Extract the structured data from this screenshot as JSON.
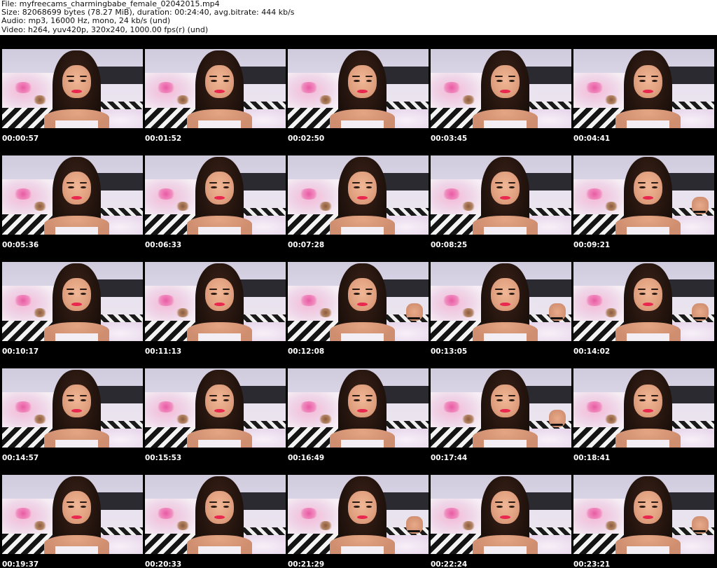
{
  "header": {
    "file": "File: myfreecams_charmingbabe_female_02042015.mp4",
    "size": "Size: 82068699 bytes (78.27 MiB), duration: 00:24:40, avg.bitrate: 444 kb/s",
    "audio": "Audio: mp3, 16000 Hz, mono, 24 kb/s (und)",
    "video": "Video: h264, yuv420p, 320x240, 1000.00 fps(r) (und)"
  },
  "thumbnails": [
    {
      "time": "00:00:57",
      "hand": false
    },
    {
      "time": "00:01:52",
      "hand": false
    },
    {
      "time": "00:02:50",
      "hand": false
    },
    {
      "time": "00:03:45",
      "hand": false
    },
    {
      "time": "00:04:41",
      "hand": false
    },
    {
      "time": "00:05:36",
      "hand": false
    },
    {
      "time": "00:06:33",
      "hand": false
    },
    {
      "time": "00:07:28",
      "hand": false
    },
    {
      "time": "00:08:25",
      "hand": false
    },
    {
      "time": "00:09:21",
      "hand": true
    },
    {
      "time": "00:10:17",
      "hand": false
    },
    {
      "time": "00:11:13",
      "hand": false
    },
    {
      "time": "00:12:08",
      "hand": true
    },
    {
      "time": "00:13:05",
      "hand": true
    },
    {
      "time": "00:14:02",
      "hand": true
    },
    {
      "time": "00:14:57",
      "hand": false
    },
    {
      "time": "00:15:53",
      "hand": false
    },
    {
      "time": "00:16:49",
      "hand": false
    },
    {
      "time": "00:17:44",
      "hand": true
    },
    {
      "time": "00:18:41",
      "hand": false
    },
    {
      "time": "00:19:37",
      "hand": false
    },
    {
      "time": "00:20:33",
      "hand": false
    },
    {
      "time": "00:21:29",
      "hand": true
    },
    {
      "time": "00:22:24",
      "hand": false
    },
    {
      "time": "00:23:21",
      "hand": true
    }
  ]
}
